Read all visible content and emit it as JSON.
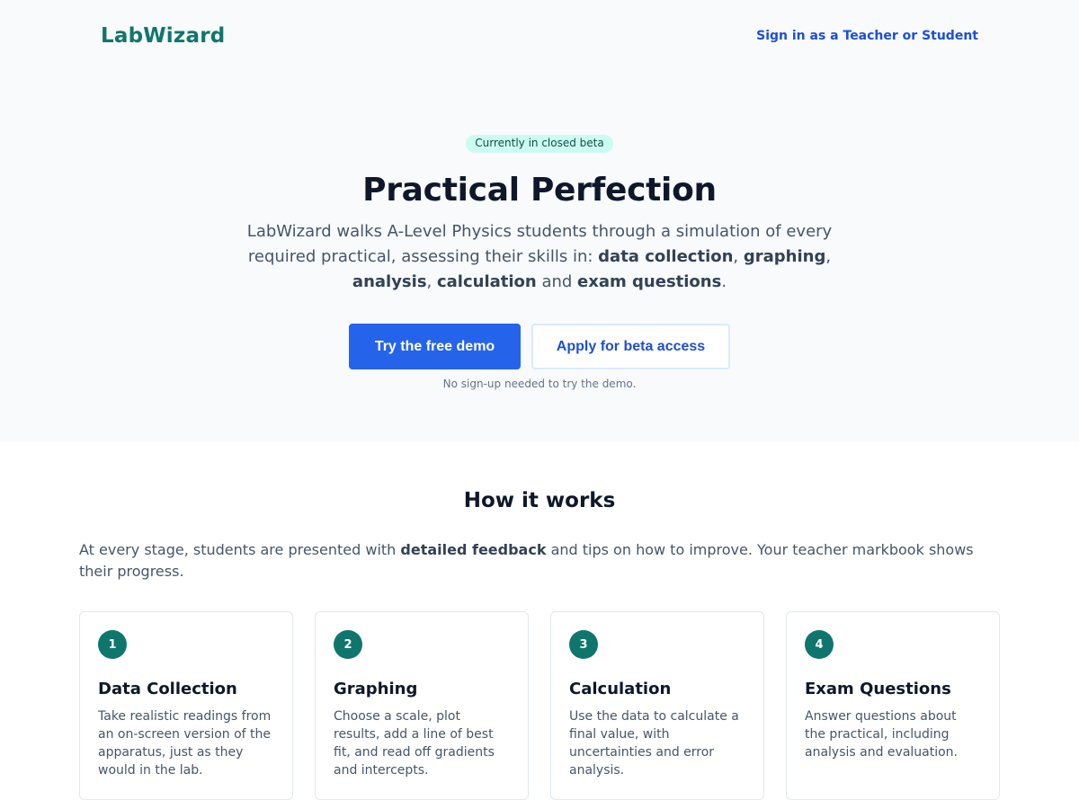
{
  "nav": {
    "logo": "LabWizard",
    "signin_label": "Sign in as a Teacher or Student"
  },
  "hero": {
    "badge": "Currently in closed beta",
    "title": "Practical Perfection",
    "lead_start": "LabWizard walks A-Level Physics students through a simulation of every required practical, assessing their skills in: ",
    "skills": [
      "data collection",
      "graphing",
      "analysis",
      "calculation",
      "exam questions"
    ],
    "sep_1": ", ",
    "sep_2": ", ",
    "sep_3": ", ",
    "sep_and": " and ",
    "lead_end": ".",
    "primary_button": "Try the free demo",
    "secondary_button": "Apply for beta access",
    "note": "No sign-up needed to try the demo."
  },
  "how": {
    "title": "How it works",
    "intro_start": "At every stage, students are presented with ",
    "intro_bold": "detailed feedback",
    "intro_end": " and tips on how to improve. Your teacher markbook shows their progress.",
    "cards": [
      {
        "number": "1",
        "title": "Data Collection",
        "text": "Take realistic readings from an on-screen version of the apparatus, just as they would in the lab."
      },
      {
        "number": "2",
        "title": "Graphing",
        "text": "Choose a scale, plot results, add a line of best fit, and read off gradients and intercepts."
      },
      {
        "number": "3",
        "title": "Calculation",
        "text": "Use the data to calculate a final value, with uncertainties and error analysis."
      },
      {
        "number": "4",
        "title": "Exam Questions",
        "text": "Answer questions about the practical, including analysis and evaluation."
      }
    ]
  },
  "colors": {
    "brand": "#0f766e",
    "primary": "#2563eb",
    "badge_bg": "#ccfbf1",
    "hero_bg": "#f8fafc"
  }
}
